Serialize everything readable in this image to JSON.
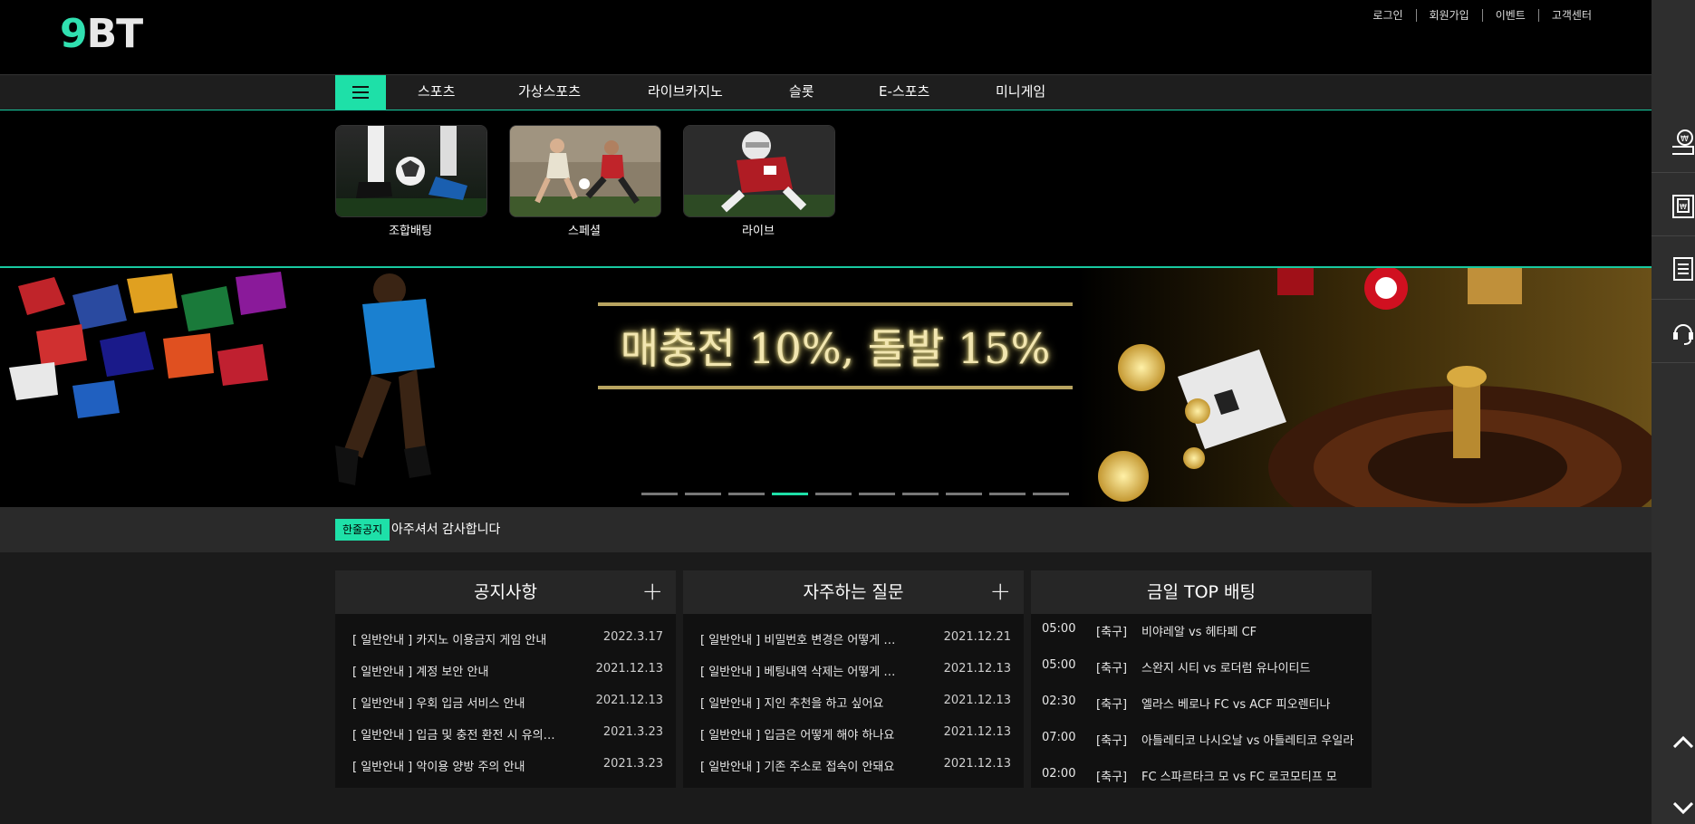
{
  "brand": {
    "logo_nine": "9",
    "logo_bt": "BT"
  },
  "top_links": [
    "로그인",
    "회원가입",
    "이벤트",
    "고객센터"
  ],
  "nav": {
    "menu_icon": "hamburger-icon",
    "items": [
      "스포츠",
      "가상스포츠",
      "라이브카지노",
      "슬롯",
      "E-스포츠",
      "미니게임"
    ]
  },
  "dropdown": {
    "cards": [
      {
        "label": "조합배팅"
      },
      {
        "label": "스페셜"
      },
      {
        "label": "라이브"
      }
    ]
  },
  "banner": {
    "headline": "매충전 10%, 돌발 15%",
    "slides_total": 10,
    "active_slide": 4
  },
  "notice": {
    "badge": "한줄공지",
    "text": "아주셔서 감사합니다"
  },
  "notices_box": {
    "title": "공지사항",
    "rows": [
      {
        "title": "[ 일반안내 ] 카지노 이용금지 게임 안내",
        "date": "2022.3.17"
      },
      {
        "title": "[ 일반안내 ] 계정 보안 안내",
        "date": "2021.12.13"
      },
      {
        "title": "[ 일반안내 ] 우회 입금 서비스 안내",
        "date": "2021.12.13"
      },
      {
        "title": "[ 일반안내 ] 입금 및 충전 환전 시 유의…",
        "date": "2021.3.23"
      },
      {
        "title": "[ 일반안내 ] 악이용 양방 주의 안내",
        "date": "2021.3.23"
      }
    ]
  },
  "faq_box": {
    "title": "자주하는 질문",
    "rows": [
      {
        "title": "[ 일반안내 ] 비밀번호 변경은 어떻게 …",
        "date": "2021.12.21"
      },
      {
        "title": "[ 일반안내 ] 베팅내역 삭제는 어떻게 …",
        "date": "2021.12.13"
      },
      {
        "title": "[ 일반안내 ] 지인 추천을 하고 싶어요",
        "date": "2021.12.13"
      },
      {
        "title": "[ 일반안내 ] 입금은 어떻게 해야 하나요",
        "date": "2021.12.13"
      },
      {
        "title": "[ 일반안내 ] 기존 주소로 접속이 안돼요",
        "date": "2021.12.13"
      }
    ]
  },
  "top_bet_box": {
    "title": "금일 TOP 배팅",
    "rows": [
      {
        "time": "05:00",
        "league": "[축구]",
        "match": "비야레알 vs 헤타페 CF"
      },
      {
        "time": "05:00",
        "league": "[축구]",
        "match": "스완지 시티 vs 로더럼 유나이티드"
      },
      {
        "time": "02:30",
        "league": "[축구]",
        "match": "엘라스 베로나 FC vs ACF 피오렌티나"
      },
      {
        "time": "07:00",
        "league": "[축구]",
        "match": "아틀레티코 나시오날 vs 아틀레티코 우일라"
      },
      {
        "time": "02:00",
        "league": "[축구]",
        "match": "FC 스파르타크 모 vs FC 로코모티프 모"
      }
    ]
  },
  "sidebar": {
    "icons": [
      "coin-deposit-icon",
      "withdraw-icon",
      "document-icon",
      "headset-icon"
    ],
    "scroll_up_icon": "chevron-up-icon",
    "scroll_down_icon": "chevron-down-icon"
  },
  "colors": {
    "accent": "#1ee0a8",
    "gold": "#d4c46a"
  }
}
